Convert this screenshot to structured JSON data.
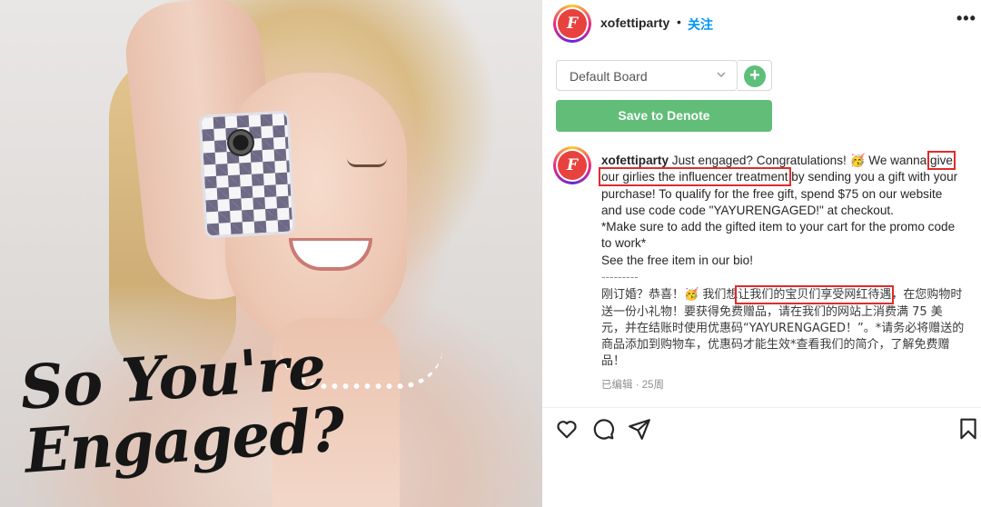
{
  "photo": {
    "headline_line1": "So You're",
    "headline_line2": "Engaged?"
  },
  "header": {
    "avatar_letter": "♀",
    "username": "xofettiparty",
    "separator": "•",
    "follow_label": "关注",
    "more_label": "•••",
    "icon_more": "more-icon"
  },
  "denote": {
    "board_value": "Default Board",
    "add_label": "+",
    "save_label": "Save to Denote",
    "accent": "#61bd78"
  },
  "caption": {
    "username": "xofettiparty",
    "part1": " Just engaged? Congratulations! 🥳 We wanna ",
    "highlight": "give our girlies the influencer treatment",
    "part2": " by sending you a gift with your purchase! To qualify for the free gift, spend $75 on our website and use code code \"YAYURENGAGED!\" at checkout.",
    "line_promo": "*Make sure to add the gifted item to your cart for the promo code to work*",
    "line_bio": "See the free item in our bio!",
    "separator": "---------",
    "zh_part1": "刚订婚？恭喜！🥳 我们想",
    "zh_highlight": "让我们的宝贝们享受网红待遇",
    "zh_part2": "，在您购物时送一份小礼物！要获得免费赠品，请在我们的网站上消费满 75 美元，并在结账时使用优惠码“YAYURENGAGED！”。*请务必将赠送的商品添加到购物车，优惠码才能生效*查看我们的简介，了解免费赠品！",
    "edited": "已编辑 · 25周",
    "highlight_color": "#e02c2c"
  },
  "actions": {
    "icons": [
      "heart-icon",
      "comment-icon",
      "share-icon",
      "bookmark-icon"
    ]
  }
}
